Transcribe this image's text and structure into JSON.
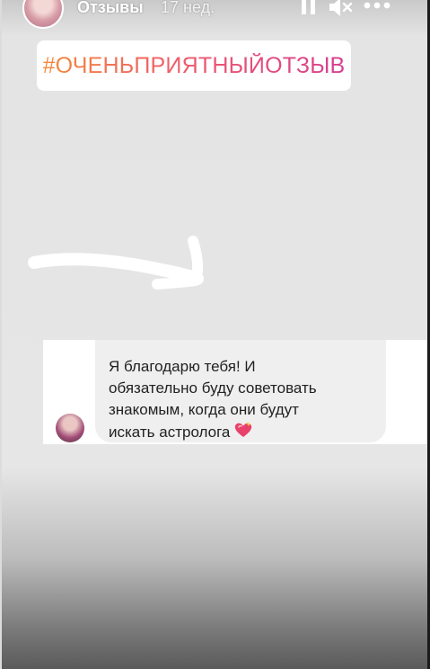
{
  "header": {
    "title": "Отзывы",
    "time": "17 нед."
  },
  "sticker": {
    "hashtag": "#ОЧЕНЬПРИЯТНЫЙОТЗЫВ"
  },
  "dm": {
    "lines": [
      "Я благодарю тебя! И",
      "обязательно буду советовать",
      "знакомым, когда они будут",
      "искать астролога"
    ],
    "emoji": "sparkling-heart-icon"
  },
  "colors": {
    "hashtag_start": "#f58a3c",
    "hashtag_end": "#d63f8f",
    "bubble": "#efefef"
  }
}
